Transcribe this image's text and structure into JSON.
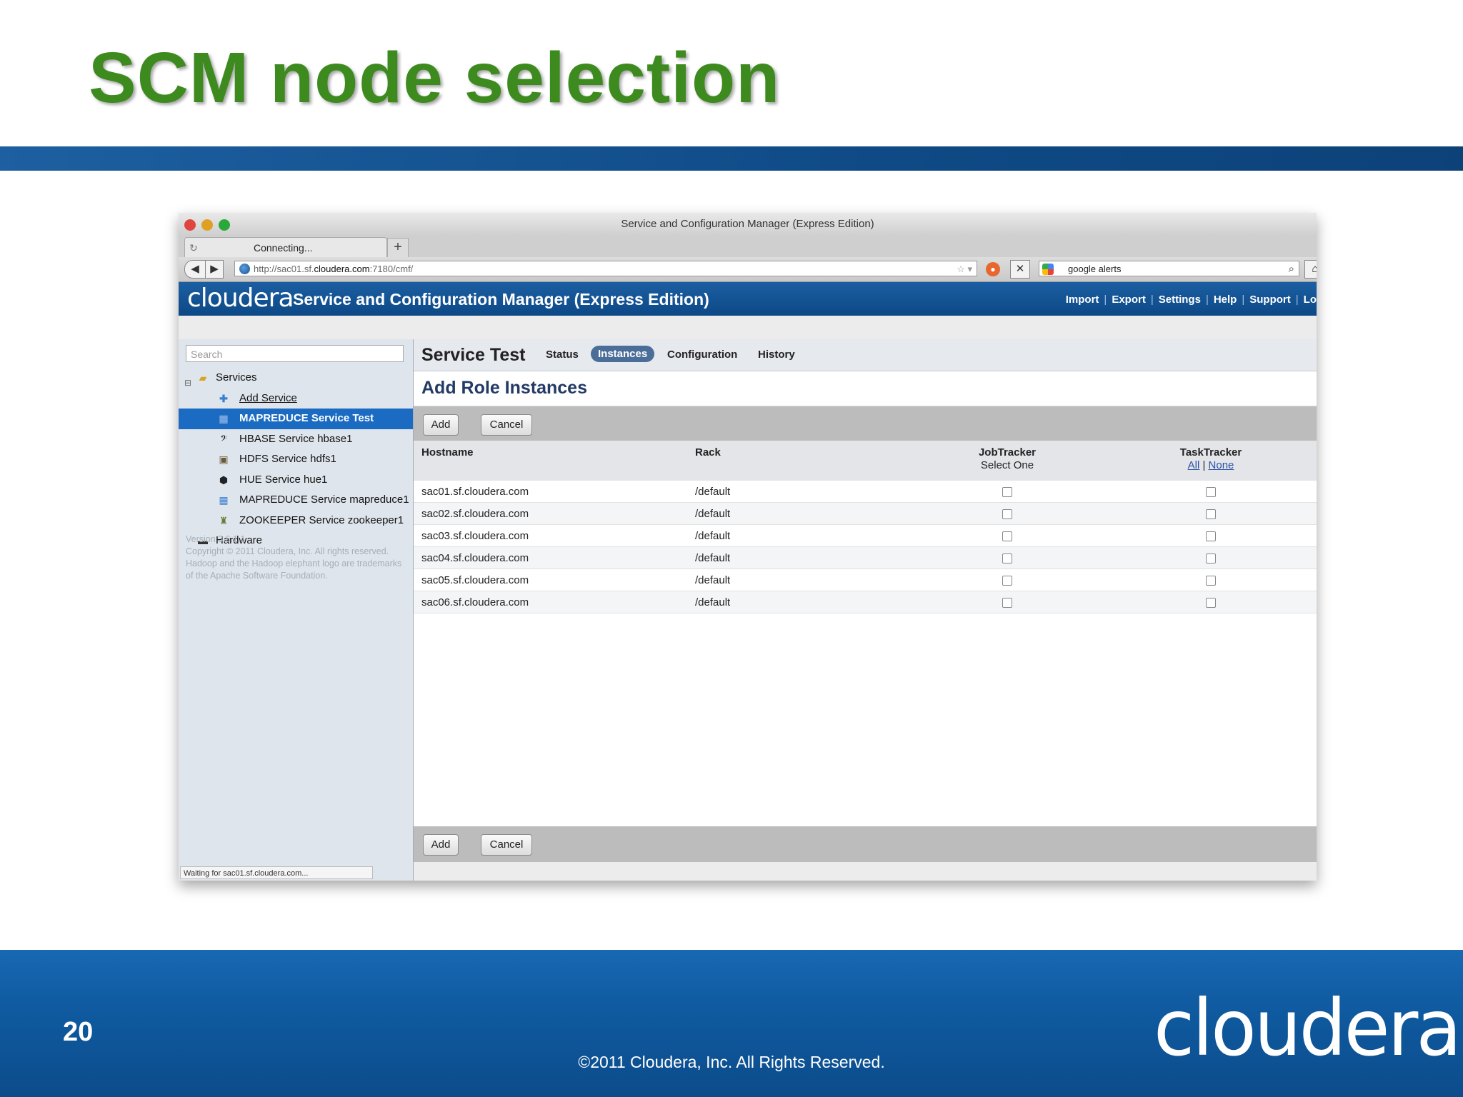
{
  "slide": {
    "title": "SCM node selection",
    "page_number": "20",
    "copyright": "©2011 Cloudera, Inc. All Rights Reserved.",
    "footer_logo": "cloudera"
  },
  "browser": {
    "window_title": "Service and Configuration Manager (Express Edition)",
    "tab_label": "Connecting...",
    "new_tab": "+",
    "url_prefix": "http://sac01.sf.",
    "url_host": "cloudera.com",
    "url_suffix": ":7180/cmf/",
    "search_value": "google alerts"
  },
  "app": {
    "logo": "cloudera",
    "title": "Service and Configuration Manager (Express Edition)",
    "links": [
      "Import",
      "Export",
      "Settings",
      "Help",
      "Support",
      "Lo"
    ]
  },
  "sidebar": {
    "search_placeholder": "Search",
    "tree": {
      "services": "Services",
      "add_service": "Add Service",
      "items": [
        {
          "label": "MAPREDUCE Service Test",
          "selected": true
        },
        {
          "label": "HBASE Service hbase1"
        },
        {
          "label": "HDFS Service hdfs1"
        },
        {
          "label": "HUE Service hue1"
        },
        {
          "label": "MAPREDUCE Service mapreduce1"
        },
        {
          "label": "ZOOKEEPER Service zookeeper1"
        }
      ],
      "hardware": "Hardware"
    },
    "version": "Version 3.6.1.1",
    "copyright": "Copyright © 2011 Cloudera, Inc. All rights reserved.",
    "trademark": "Hadoop and the Hadoop elephant logo are trademarks of the Apache Software Foundation.",
    "status": "Waiting for sac01.sf.cloudera.com..."
  },
  "service": {
    "title": "Service Test",
    "tabs": [
      "Status",
      "Instances",
      "Configuration",
      "History"
    ],
    "active_tab": "Instances"
  },
  "roles": {
    "title": "Add Role Instances",
    "add_label": "Add",
    "cancel_label": "Cancel",
    "columns": {
      "hostname": "Hostname",
      "rack": "Rack",
      "jobtracker": "JobTracker",
      "jobtracker_sub": "Select One",
      "tasktracker": "TaskTracker",
      "all": "All",
      "divider": "|",
      "none": "None"
    },
    "rows": [
      {
        "host": "sac01.sf.cloudera.com",
        "rack": "/default"
      },
      {
        "host": "sac02.sf.cloudera.com",
        "rack": "/default"
      },
      {
        "host": "sac03.sf.cloudera.com",
        "rack": "/default"
      },
      {
        "host": "sac04.sf.cloudera.com",
        "rack": "/default"
      },
      {
        "host": "sac05.sf.cloudera.com",
        "rack": "/default"
      },
      {
        "host": "sac06.sf.cloudera.com",
        "rack": "/default"
      }
    ]
  }
}
